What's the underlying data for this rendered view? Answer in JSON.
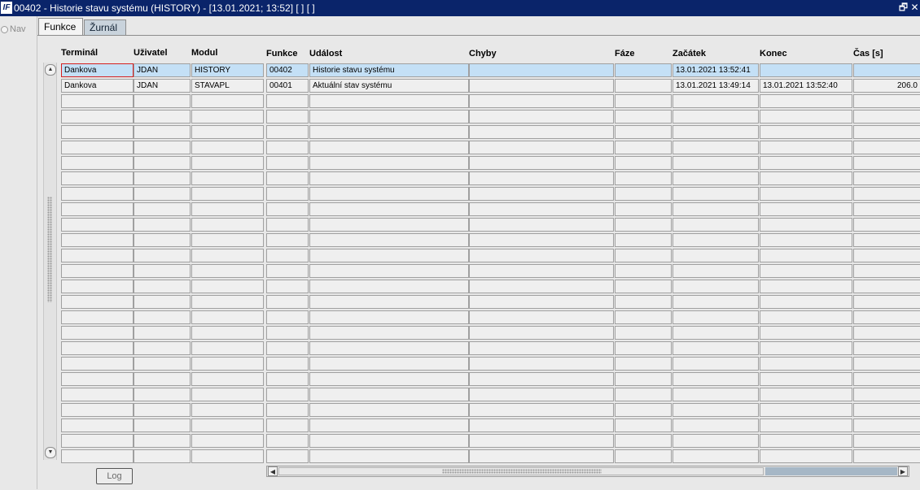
{
  "window": {
    "title": "00402 - Historie stavu systému (HISTORY) - [13.01.2021; 13:52]  [ ]  [ ]",
    "app_icon": "IF",
    "restore_glyph": "🗗",
    "close_glyph": "✕"
  },
  "nav": {
    "label": "Nav"
  },
  "tabs": [
    {
      "label": "Funkce",
      "active": true
    },
    {
      "label": "Žurnál",
      "active": false
    }
  ],
  "columns": [
    "Terminál",
    "Uživatel",
    "Modul",
    "Funkce",
    "Událost",
    "Chyby",
    "Fáze",
    "Začátek",
    "Konec",
    "Čas [s]"
  ],
  "rows": [
    [
      "Dankova",
      "JDAN",
      "HISTORY",
      "00402",
      "Historie stavu systému",
      "",
      "",
      "13.01.2021 13:52:41",
      "",
      ""
    ],
    [
      "Dankova",
      "JDAN",
      "STAVAPL",
      "00401",
      "Aktuální stav systému",
      "",
      "",
      "13.01.2021 13:49:14",
      "13.01.2021 13:52:40",
      "206.0"
    ]
  ],
  "empty_row_count": 24,
  "selected_row": 0,
  "log_button": {
    "label": "Log"
  },
  "colors": {
    "titlebar": "#0a246a",
    "selected_row": "#c4e0f6",
    "focus_border": "#d42020"
  },
  "icons": {
    "scroll_up": "▲",
    "scroll_down": "▼",
    "scroll_left": "◀",
    "scroll_right": "▶"
  }
}
